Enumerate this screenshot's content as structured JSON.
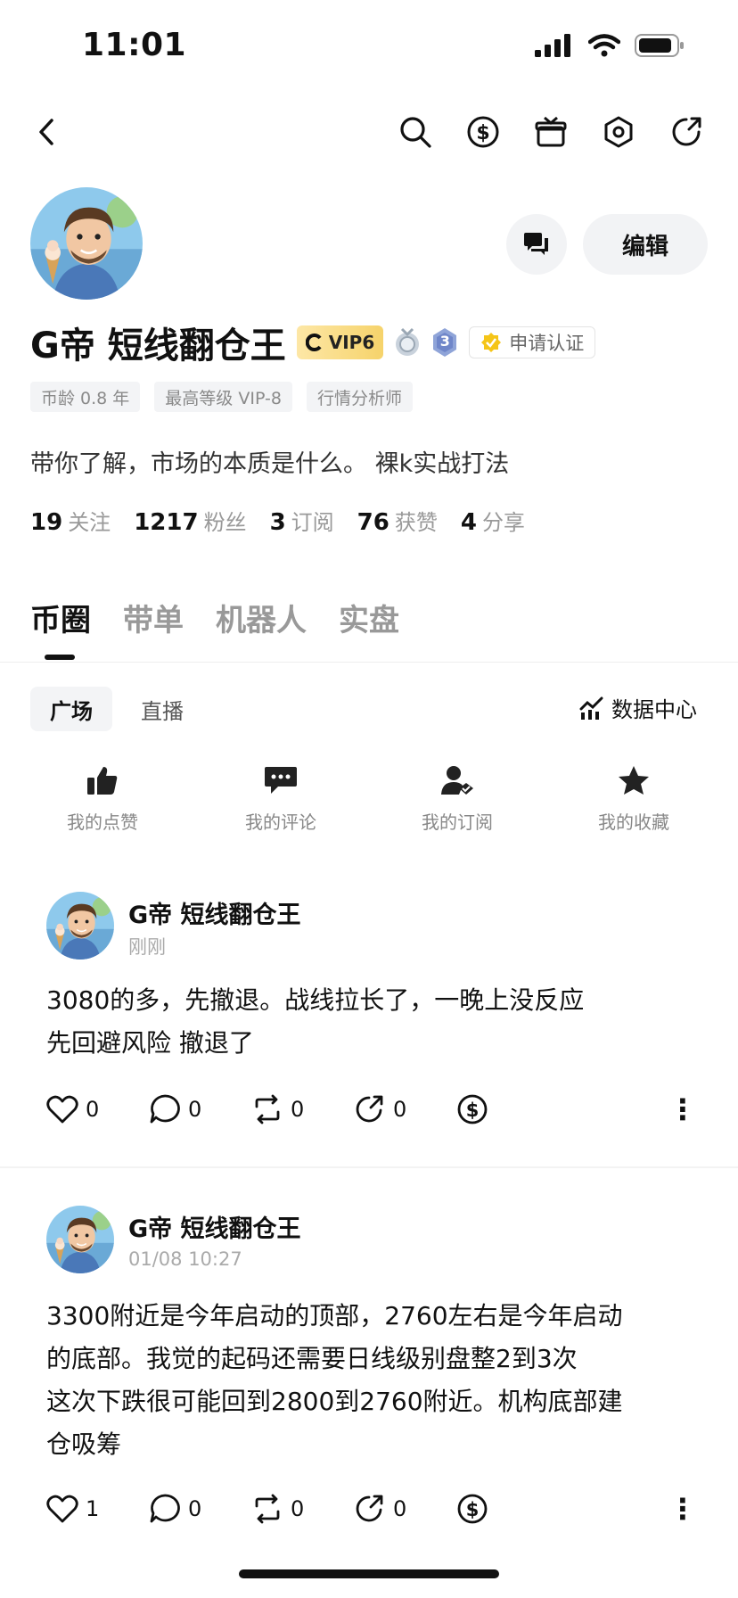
{
  "status_bar": {
    "time": "11:01"
  },
  "profile": {
    "name": "G帝  短线翻仓王",
    "vip_label": "VIP6",
    "medal_level": "3",
    "verify_label": "申请认证",
    "tags": [
      "币龄 0.8 年",
      "最高等级 VIP-8",
      "行情分析师"
    ],
    "bio": "带你了解，市场的本质是什么。 裸k实战打法",
    "edit_label": "编辑",
    "stats": [
      {
        "num": "19",
        "label": "关注"
      },
      {
        "num": "1217",
        "label": "粉丝"
      },
      {
        "num": "3",
        "label": "订阅"
      },
      {
        "num": "76",
        "label": "获赞"
      },
      {
        "num": "4",
        "label": "分享"
      }
    ]
  },
  "tabs": [
    "币圈",
    "带单",
    "机器人",
    "实盘"
  ],
  "sub_tabs": [
    "广场",
    "直播"
  ],
  "data_center_label": "数据中心",
  "quick_actions": [
    "我的点赞",
    "我的评论",
    "我的订阅",
    "我的收藏"
  ],
  "posts": [
    {
      "author": "G帝  短线翻仓王",
      "time": "刚刚",
      "lines": [
        "3080的多，先撤退。战线拉长了，一晚上没反应",
        "先回避风险 撤退了"
      ],
      "likes": "0",
      "comments": "0",
      "reposts": "0",
      "shares": "0"
    },
    {
      "author": "G帝  短线翻仓王",
      "time": "01/08 10:27",
      "lines": [
        "3300附近是今年启动的顶部，2760左右是今年启动",
        "的底部。我觉的起码还需要日线级别盘整2到3次",
        "这次下跌很可能回到2800到2760附近。机构底部建",
        "仓吸筹"
      ],
      "likes": "1",
      "comments": "0",
      "reposts": "0",
      "shares": "0"
    }
  ],
  "colors": {
    "accent": "#111111",
    "vip_gold": "#f6d36b",
    "muted": "#999999"
  }
}
